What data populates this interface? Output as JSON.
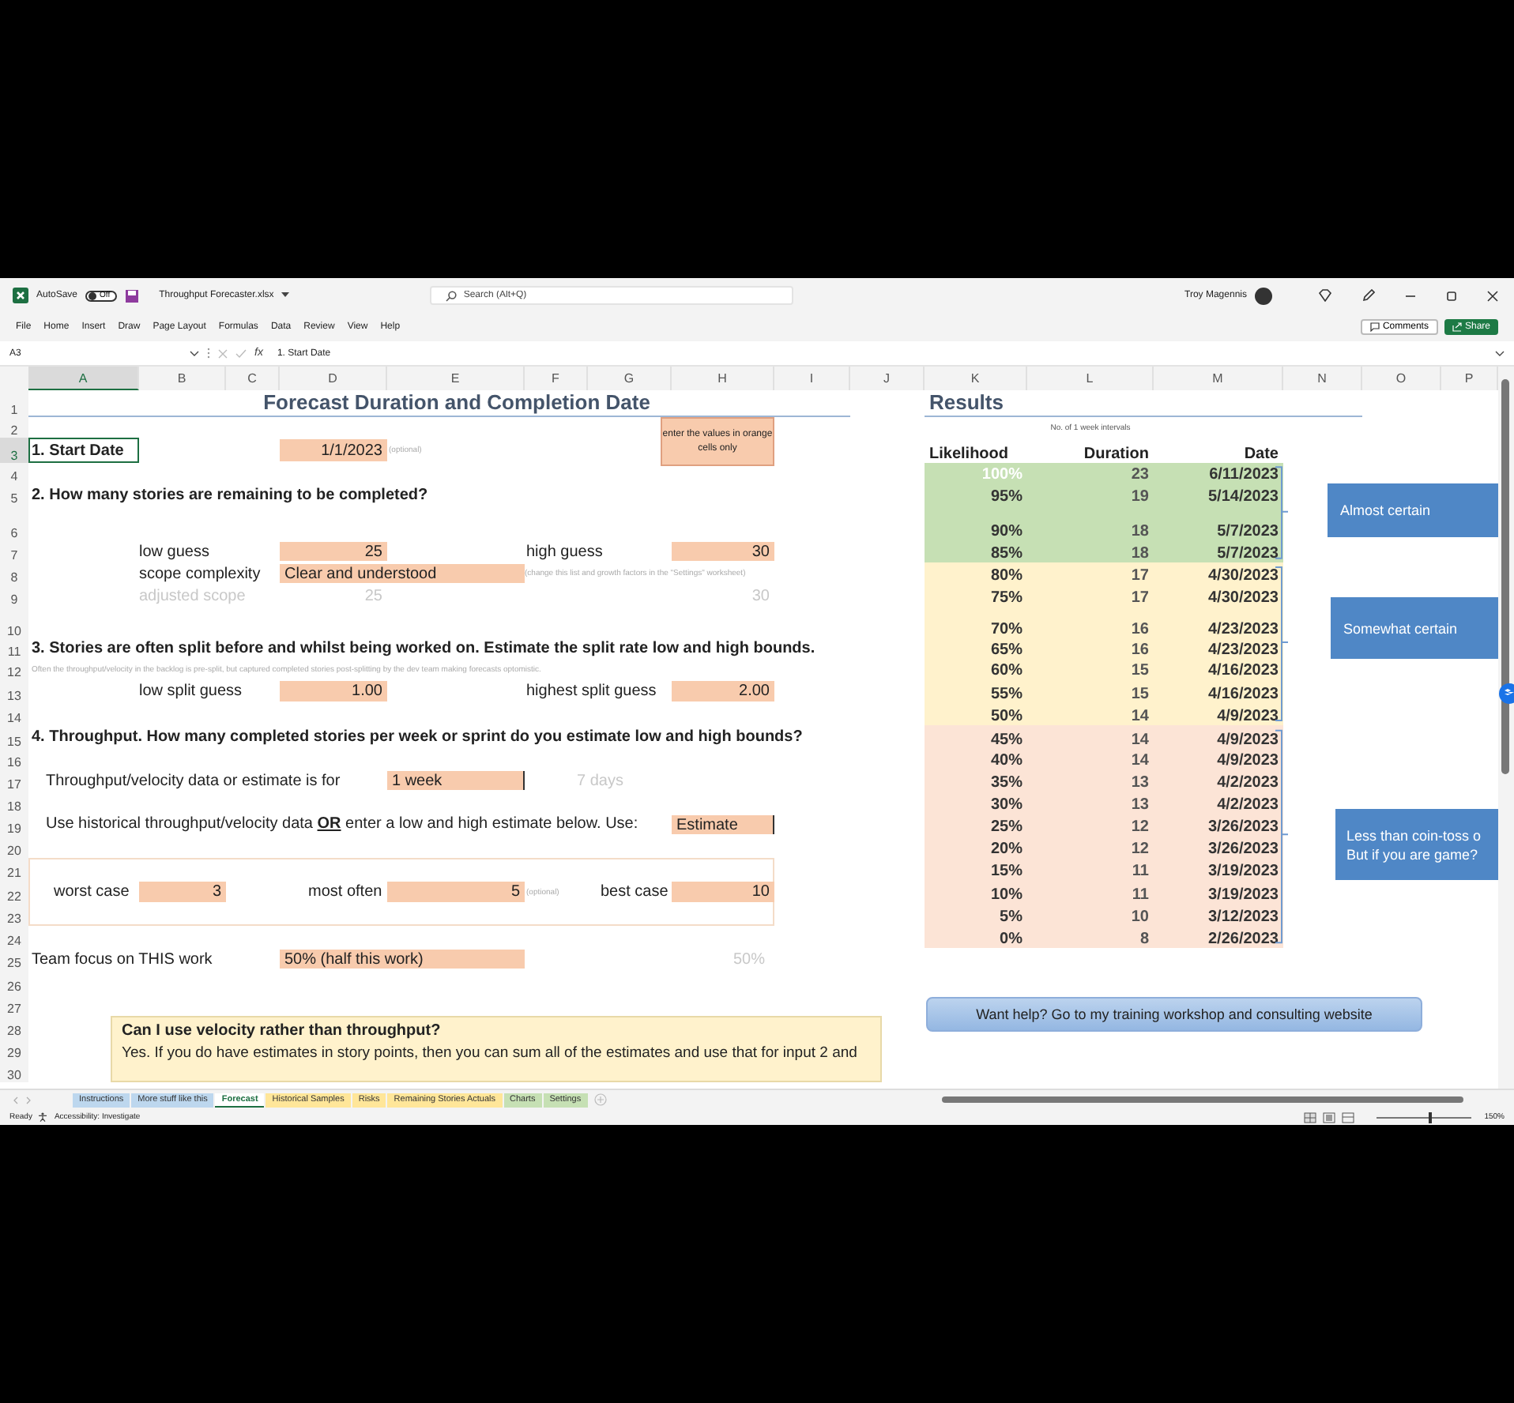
{
  "titlebar": {
    "autosave_label": "AutoSave",
    "autosave_on": false,
    "autosave_state": "Off",
    "file_name": "Throughput Forecaster.xlsx",
    "search_placeholder": "Search (Alt+Q)",
    "user": "Troy Magennis"
  },
  "menu": [
    {
      "label": "File",
      "selected": false
    },
    {
      "label": "Home",
      "selected": false
    },
    {
      "label": "Insert",
      "selected": false
    },
    {
      "label": "Draw",
      "selected": false
    },
    {
      "label": "Page Layout",
      "selected": false
    },
    {
      "label": "Formulas",
      "selected": false
    },
    {
      "label": "Data",
      "selected": false
    },
    {
      "label": "Review",
      "selected": false
    },
    {
      "label": "View",
      "selected": false
    },
    {
      "label": "Help",
      "selected": false
    }
  ],
  "comments_button": "Comments",
  "share_button": "Share",
  "formula_bar": {
    "name_box": "A3",
    "function_label": "fx",
    "formula": "1. Start Date"
  },
  "column_headers": [
    {
      "label": "A",
      "selected": true
    },
    {
      "label": "B",
      "selected": false
    },
    {
      "label": "C",
      "selected": false
    },
    {
      "label": "D",
      "selected": false
    },
    {
      "label": "E",
      "selected": false
    },
    {
      "label": "F",
      "selected": false
    },
    {
      "label": "G",
      "selected": false
    },
    {
      "label": "H",
      "selected": false
    },
    {
      "label": "I",
      "selected": false
    },
    {
      "label": "J",
      "selected": false
    },
    {
      "label": "K",
      "selected": false
    },
    {
      "label": "L",
      "selected": false
    },
    {
      "label": "M",
      "selected": false
    },
    {
      "label": "N",
      "selected": false
    },
    {
      "label": "O",
      "selected": false
    },
    {
      "label": "P",
      "selected": false
    }
  ],
  "row_numbers": [
    {
      "label": "1",
      "selected": false
    },
    {
      "label": "2",
      "selected": false
    },
    {
      "label": "3",
      "selected": true
    },
    {
      "label": "4",
      "selected": false
    },
    {
      "label": "5",
      "selected": false
    },
    {
      "label": "6",
      "selected": false
    },
    {
      "label": "7",
      "selected": false
    },
    {
      "label": "8",
      "selected": false
    },
    {
      "label": "9",
      "selected": false
    },
    {
      "label": "10",
      "selected": false
    },
    {
      "label": "11",
      "selected": false
    },
    {
      "label": "12",
      "selected": false
    },
    {
      "label": "13",
      "selected": false
    },
    {
      "label": "14",
      "selected": false
    },
    {
      "label": "15",
      "selected": false
    },
    {
      "label": "16",
      "selected": false
    },
    {
      "label": "17",
      "selected": false
    },
    {
      "label": "18",
      "selected": false
    },
    {
      "label": "19",
      "selected": false
    },
    {
      "label": "20",
      "selected": false
    },
    {
      "label": "21",
      "selected": false
    },
    {
      "label": "22",
      "selected": false
    },
    {
      "label": "23",
      "selected": false
    },
    {
      "label": "24",
      "selected": false
    },
    {
      "label": "25",
      "selected": false
    },
    {
      "label": "26",
      "selected": false
    },
    {
      "label": "27",
      "selected": false
    },
    {
      "label": "28",
      "selected": false
    },
    {
      "label": "29",
      "selected": false
    },
    {
      "label": "30",
      "selected": false
    }
  ],
  "sheet": {
    "title": "Forecast Duration and Completion Date",
    "orange_note": "enter the values in orange cells only",
    "start": {
      "label": "1. Start Date",
      "selected": true,
      "value": "1/1/2023",
      "hint": "(optional)"
    },
    "stories": {
      "heading": "2. How many stories are remaining to be completed?",
      "low_label": "low guess",
      "low": "25",
      "high_label": "high guess",
      "high": "30",
      "scope_label": "scope complexity",
      "scope": "Clear and understood",
      "scope_note": "(change this list and growth factors in the \"Settings\" worksheet)",
      "adjusted_label": "adjusted scope",
      "adjusted_low": "25",
      "adjusted_high": "30"
    },
    "split": {
      "heading": "3. Stories are often split before and whilst being worked on. Estimate the split rate low and high bounds.",
      "note": "Often the throughput/velocity in the backlog is pre-split, but captured completed stories post-splitting by the dev team making forecasts optomistic.",
      "low_label": "low split guess",
      "low": "1.00",
      "high_label": "highest split guess",
      "high": "2.00"
    },
    "throughput": {
      "heading": "4. Throughput. How many completed stories per week or sprint do you estimate low and high bounds?",
      "period_label": "Throughput/velocity data or estimate is for",
      "period": "1 week",
      "period_days": "7 days",
      "source_label": "Use historical throughput/velocity data **OR** enter a low and high estimate below. Use:",
      "source": "Estimate",
      "worst_label": "worst case",
      "worst": "3",
      "often_label": "most often",
      "often": "5",
      "often_hint": "(optional)",
      "best_label": "best case",
      "best": "10"
    },
    "focus": {
      "label": "Team focus on THIS work",
      "value": "50% (half this work)",
      "percent": "50%"
    },
    "faq": {
      "question": "Can I use velocity rather than throughput?",
      "answer": "Yes. If you do have estimates in story points, then you can sum all of the estimates and use that for input 2 and"
    }
  },
  "results": {
    "title": "Results",
    "intervals_note": "No. of 1 week intervals",
    "headers": [
      "Likelihood",
      "Duration",
      "Date"
    ],
    "rows": [
      {
        "likelihood": "100%",
        "duration": "23",
        "date": "6/11/2023",
        "color": "#c6e0b4",
        "faded": true
      },
      {
        "likelihood": "95%",
        "duration": "19",
        "date": "5/14/2023",
        "color": "#c6e0b4",
        "faded": false
      },
      {
        "likelihood": "90%",
        "duration": "18",
        "date": "5/7/2023",
        "color": "#c6e0b4",
        "faded": false
      },
      {
        "likelihood": "85%",
        "duration": "18",
        "date": "5/7/2023",
        "color": "#c6e0b4",
        "faded": false
      },
      {
        "likelihood": "80%",
        "duration": "17",
        "date": "4/30/2023",
        "color": "#fff2cc",
        "faded": false
      },
      {
        "likelihood": "75%",
        "duration": "17",
        "date": "4/30/2023",
        "color": "#fff2cc",
        "faded": false
      },
      {
        "likelihood": "70%",
        "duration": "16",
        "date": "4/23/2023",
        "color": "#fff2cc",
        "faded": false
      },
      {
        "likelihood": "65%",
        "duration": "16",
        "date": "4/23/2023",
        "color": "#fff2cc",
        "faded": false
      },
      {
        "likelihood": "60%",
        "duration": "15",
        "date": "4/16/2023",
        "color": "#fff2cc",
        "faded": false
      },
      {
        "likelihood": "55%",
        "duration": "15",
        "date": "4/16/2023",
        "color": "#fff2cc",
        "faded": false
      },
      {
        "likelihood": "50%",
        "duration": "14",
        "date": "4/9/2023",
        "color": "#fff2cc",
        "faded": false
      },
      {
        "likelihood": "45%",
        "duration": "14",
        "date": "4/9/2023",
        "color": "#fce4d6",
        "faded": false
      },
      {
        "likelihood": "40%",
        "duration": "14",
        "date": "4/9/2023",
        "color": "#fce4d6",
        "faded": false
      },
      {
        "likelihood": "35%",
        "duration": "13",
        "date": "4/2/2023",
        "color": "#fce4d6",
        "faded": false
      },
      {
        "likelihood": "30%",
        "duration": "13",
        "date": "4/2/2023",
        "color": "#fce4d6",
        "faded": false
      },
      {
        "likelihood": "25%",
        "duration": "12",
        "date": "3/26/2023",
        "color": "#fce4d6",
        "faded": false
      },
      {
        "likelihood": "20%",
        "duration": "12",
        "date": "3/26/2023",
        "color": "#fce4d6",
        "faded": false
      },
      {
        "likelihood": "15%",
        "duration": "11",
        "date": "3/19/2023",
        "color": "#fce4d6",
        "faded": false
      },
      {
        "likelihood": "10%",
        "duration": "11",
        "date": "3/19/2023",
        "color": "#fce4d6",
        "faded": false
      },
      {
        "likelihood": "5%",
        "duration": "10",
        "date": "3/12/2023",
        "color": "#fce4d6",
        "faded": false
      },
      {
        "likelihood": "0%",
        "duration": "8",
        "date": "2/26/2023",
        "color": "#fce4d6",
        "faded": false
      }
    ],
    "groups": [
      {
        "lines": [
          "Almost certain"
        ]
      },
      {
        "lines": [
          "Somewhat certain"
        ]
      },
      {
        "lines": [
          "Less than coin-toss o",
          "But if you are game?"
        ]
      }
    ],
    "help_button": "Want help? Go to my training workshop and consulting website"
  },
  "sheet_tabs": [
    {
      "label": "Instructions",
      "color": "#bdd7ee",
      "selected": false
    },
    {
      "label": "More stuff like this",
      "color": "#bdd7ee",
      "selected": false
    },
    {
      "label": "Forecast",
      "color": "#ffffff",
      "selected": true
    },
    {
      "label": "Historical Samples",
      "color": "#ffe699",
      "selected": false
    },
    {
      "label": "Risks",
      "color": "#ffe699",
      "selected": false
    },
    {
      "label": "Remaining Stories Actuals",
      "color": "#ffe699",
      "selected": false
    },
    {
      "label": "Charts",
      "color": "#c6e0b4",
      "selected": false
    },
    {
      "label": "Settings",
      "color": "#c6e0b4",
      "selected": false
    }
  ],
  "status_bar": {
    "ready": "Ready",
    "accessibility": "Accessibility: Investigate",
    "zoom": "150%",
    "zoom_slider": {
      "level": 0.55
    }
  }
}
